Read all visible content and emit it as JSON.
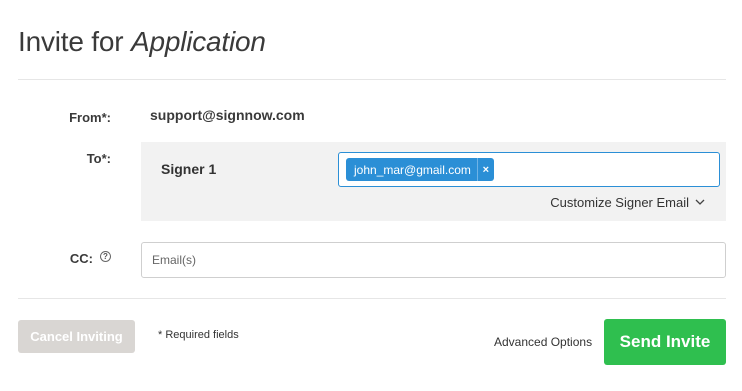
{
  "header": {
    "title_prefix": "Invite for",
    "title_emphasis": "Application"
  },
  "form": {
    "from_label": "From*:",
    "from_value": "support@signnow.com",
    "to_label": "To*:",
    "signers": [
      {
        "name": "Signer 1",
        "email_chip": "john_mar@gmail.com",
        "remove_symbol": "×"
      }
    ],
    "customize_label": "Customize Signer Email",
    "cc_label": "CC:",
    "cc_help_symbol": "?",
    "cc_placeholder": "Email(s)"
  },
  "footer": {
    "cancel_label": "Cancel Inviting",
    "required_note": "* Required fields",
    "advanced_label": "Advanced Options",
    "send_label": "Send Invite"
  },
  "colors": {
    "accent_blue": "#2b8fd6",
    "send_green": "#2fbf4f",
    "disabled_gray": "#d9d6d3",
    "panel_bg": "#f2f2f2"
  },
  "icons": {
    "help": "help-icon",
    "remove": "close-icon",
    "customize_toggle": "chevron-down-icon"
  }
}
